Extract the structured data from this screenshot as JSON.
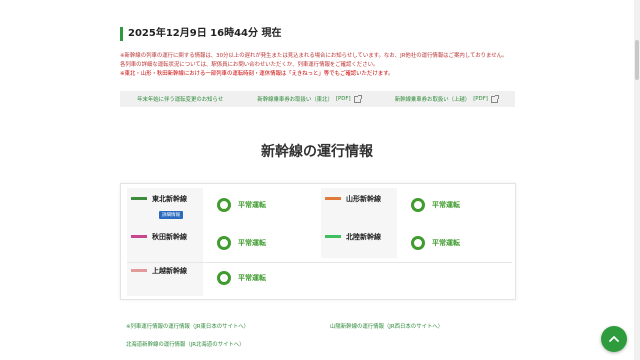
{
  "datetime": "2025年12月9日 16時44分 現在",
  "notice": {
    "lines": [
      "※新幹線の列車の運行に関する情報は、30分以上の遅れが発生または見込まれる場合にお知らせしています。なお、JR他社の運行情報はご案内しておりません。",
      "各列車の詳細な運転状況については、駅係員にお問い合わせいただくか、列車運行情報をご確認ください。",
      "※東北・山形・秋田新幹線における一部列車の運転時刻・運休情報は「えきねっと」等でもご確認いただけます。"
    ]
  },
  "linkbar": [
    {
      "label": "年末年始に伴う運転変更のお知らせ",
      "pdf": ""
    },
    {
      "label": "新幹線乗車券お取扱い（東北）",
      "pdf": "[PDF]"
    },
    {
      "label": "新幹線乗車券お取扱い（上越）",
      "pdf": "[PDF]"
    }
  ],
  "section_title": "新幹線の運行情報",
  "lines": [
    {
      "name": "東北新幹線",
      "status": "平常運転",
      "color": "#3d8b3d",
      "badge": "詳細情報"
    },
    {
      "name": "山形新幹線",
      "status": "平常運転",
      "color": "#e07a3a"
    },
    {
      "name": "秋田新幹線",
      "status": "平常運転",
      "color": "#c8468e"
    },
    {
      "name": "北陸新幹線",
      "status": "平常運転",
      "color": "#3fbf5f"
    },
    {
      "name": "上越新幹線",
      "status": "平常運転",
      "color": "#e59a9a"
    }
  ],
  "footer_links": [
    {
      "label": "※列車運行情報の運行情報（JR東日本のサイトへ）"
    },
    {
      "label": "山陽新幹線の運行情報（JR西日本のサイトへ）"
    },
    {
      "label": "北海道新幹線の運行情報（JR北海道のサイトへ）"
    }
  ],
  "colors": {
    "accent": "#2e9c3c",
    "status": "#3f9b2e",
    "notice": "#c00000"
  }
}
